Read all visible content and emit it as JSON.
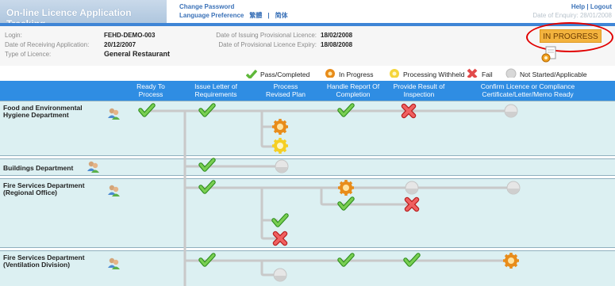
{
  "header": {
    "title": "On-line Licence Application Tracking",
    "change_password": "Change Password",
    "language_preference": "Language Preference",
    "lang_trad": "繁體",
    "lang_sep": "|",
    "lang_simp": "简体",
    "help": "Help",
    "help_sep": "|",
    "logout": "Logout",
    "date_of_enquiry": "Date of Enquiry: 28/01/2008"
  },
  "info": {
    "login_label": "Login:",
    "login_value": "FEHD-DEMO-003",
    "receiving_label": "Date of Receiving Application:",
    "receiving_value": "20/12/2007",
    "type_label": "Type of Licence:",
    "type_value": "General Restaurant",
    "issuing_label": "Date of Issuing Provisional Licence:",
    "issuing_value": "18/02/2008",
    "expiry_label": "Date of Provisional Licence Expiry:",
    "expiry_value": "18/08/2008",
    "status": "IN PROGRESS"
  },
  "legend": [
    {
      "icon": "check-icon",
      "label": "Pass/Completed"
    },
    {
      "icon": "gear-icon",
      "label": "In Progress"
    },
    {
      "icon": "gear-icon",
      "label": "Processing Withheld"
    },
    {
      "icon": "cross-icon",
      "label": "Fail"
    },
    {
      "icon": "grey-dot-icon",
      "label": "Not Started/Applicable"
    }
  ],
  "columns": [
    "Ready To\nProcess",
    "Issue Letter of\nRequirements",
    "Process\nRevised Plan",
    "Handle Report Of\nCompletion",
    "Provide Result of\nInspection",
    "Confirm Licence or Compliance\nCertificate/Letter/Memo Ready"
  ],
  "departments": [
    "Food and Environmental Hygiene Department",
    "Buildings Department",
    "Fire Services Department (Regional Office)",
    "Fire Services Department (Ventilation Division)"
  ],
  "colors": {
    "header_blue": "#3e85d6",
    "column_header": "#2f8de3",
    "row_bg": "#dcf0f2",
    "status_badge": "#f3b33e",
    "highlight_circle": "#e10000"
  }
}
